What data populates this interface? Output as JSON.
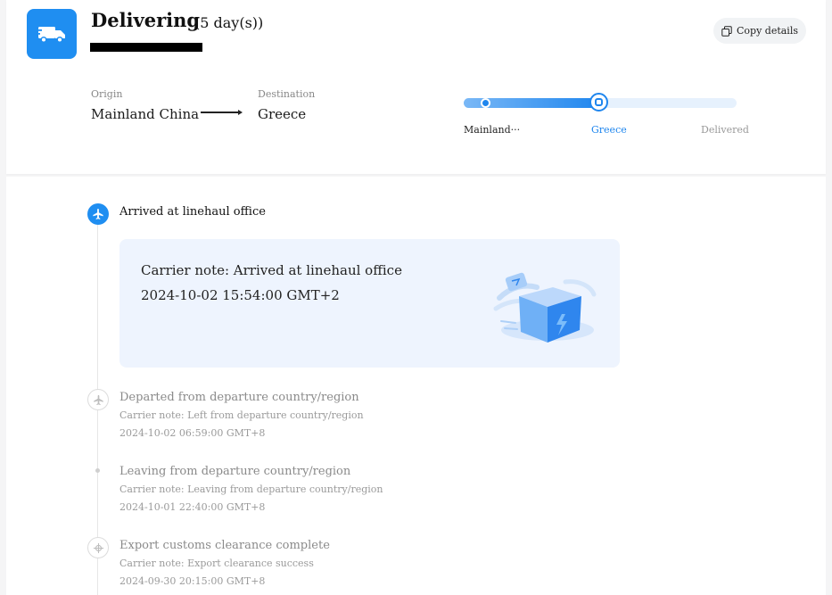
{
  "header": {
    "status": "Delivering",
    "days": "(5 day(s))",
    "copy_label": "Copy details"
  },
  "route": {
    "origin_label": "Origin",
    "origin_value": "Mainland China",
    "destination_label": "Destination",
    "destination_value": "Greece"
  },
  "progress": {
    "fraction": 0.5,
    "stages": [
      "Mainland···",
      "Greece",
      "Delivered"
    ]
  },
  "colors": {
    "accent": "#1f8ef1",
    "muted_text": "#8a8a8a",
    "card_bg": "#eef4fe"
  },
  "timeline": {
    "current": {
      "icon": "plane-icon",
      "title": "Arrived at linehaul office",
      "note": "Carrier note: Arrived at linehaul office",
      "time": "2024-10-02 15:54:00 GMT+2"
    },
    "events": [
      {
        "icon": "plane-icon",
        "title": "Departed from departure country/region",
        "note": "Carrier note: Left from departure country/region",
        "time": "2024-10-02 06:59:00 GMT+8"
      },
      {
        "icon": "dot",
        "title": "Leaving from departure country/region",
        "note": "Carrier note: Leaving from departure country/region",
        "time": "2024-10-01 22:40:00 GMT+8"
      },
      {
        "icon": "customs-icon",
        "title": "Export customs clearance complete",
        "note": "Carrier note: Export clearance success",
        "time": "2024-09-30 20:15:00 GMT+8"
      }
    ]
  }
}
